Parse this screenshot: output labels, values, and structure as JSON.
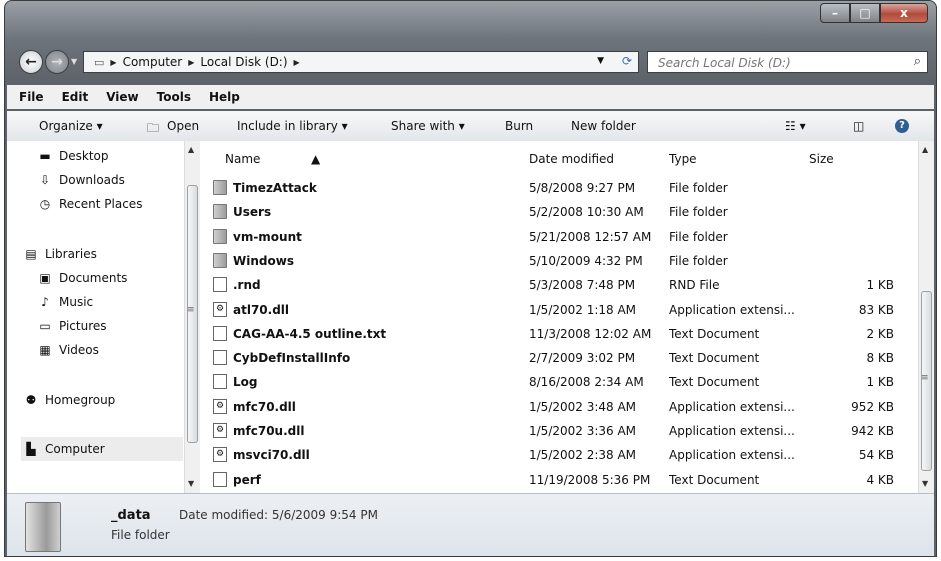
{
  "window": {
    "minimize_glyph": "–",
    "maximize_glyph": "□",
    "close_glyph": "x"
  },
  "address": {
    "crumbs": [
      "Computer",
      "Local Disk (D:)"
    ],
    "search_placeholder": "Search Local Disk (D:)"
  },
  "menu": [
    "File",
    "Edit",
    "View",
    "Tools",
    "Help"
  ],
  "toolbar": {
    "organize": "Organize ▾",
    "open": "Open",
    "include_in_library": "Include in library ▾",
    "share_with": "Share with ▾",
    "burn": "Burn",
    "new_folder": "New folder"
  },
  "nav": [
    {
      "label": "Desktop",
      "icon": "desktop-icon"
    },
    {
      "label": "Downloads",
      "icon": "downloads-icon"
    },
    {
      "label": "Recent Places",
      "icon": "recent-places-icon"
    },
    {
      "label": "Libraries",
      "icon": "libraries-icon"
    },
    {
      "label": "Documents",
      "icon": "documents-icon"
    },
    {
      "label": "Music",
      "icon": "music-icon"
    },
    {
      "label": "Pictures",
      "icon": "pictures-icon"
    },
    {
      "label": "Videos",
      "icon": "videos-icon"
    },
    {
      "label": "Homegroup",
      "icon": "homegroup-icon"
    },
    {
      "label": "Computer",
      "icon": "computer-icon"
    }
  ],
  "columns": {
    "name": "Name",
    "date": "Date modified",
    "type": "Type",
    "size": "Size"
  },
  "files": [
    {
      "name": "TimezAttack",
      "date": "5/8/2008 9:27 PM",
      "type": "File folder",
      "size": "",
      "kind": "folder"
    },
    {
      "name": "Users",
      "date": "5/2/2008 10:30 AM",
      "type": "File folder",
      "size": "",
      "kind": "folder"
    },
    {
      "name": "vm-mount",
      "date": "5/21/2008 12:57 AM",
      "type": "File folder",
      "size": "",
      "kind": "folder"
    },
    {
      "name": "Windows",
      "date": "5/10/2009 4:32 PM",
      "type": "File folder",
      "size": "",
      "kind": "folder"
    },
    {
      "name": ".rnd",
      "date": "5/3/2008 7:48 PM",
      "type": "RND File",
      "size": "1 KB",
      "kind": "doc"
    },
    {
      "name": "atl70.dll",
      "date": "1/5/2002 1:18 AM",
      "type": "Application extensi...",
      "size": "83 KB",
      "kind": "dll"
    },
    {
      "name": "CAG-AA-4.5 outline.txt",
      "date": "11/3/2008 12:02 AM",
      "type": "Text Document",
      "size": "2 KB",
      "kind": "doc"
    },
    {
      "name": "CybDefInstallInfo",
      "date": "2/7/2009 3:02 PM",
      "type": "Text Document",
      "size": "8 KB",
      "kind": "doc"
    },
    {
      "name": "Log",
      "date": "8/16/2008 2:34 AM",
      "type": "Text Document",
      "size": "1 KB",
      "kind": "doc"
    },
    {
      "name": "mfc70.dll",
      "date": "1/5/2002 3:48 AM",
      "type": "Application extensi...",
      "size": "952 KB",
      "kind": "dll"
    },
    {
      "name": "mfc70u.dll",
      "date": "1/5/2002 3:36 AM",
      "type": "Application extensi...",
      "size": "942 KB",
      "kind": "dll"
    },
    {
      "name": "msvci70.dll",
      "date": "1/5/2002 2:38 AM",
      "type": "Application extensi...",
      "size": "54 KB",
      "kind": "dll"
    },
    {
      "name": "perf",
      "date": "11/19/2008 5:36 PM",
      "type": "Text Document",
      "size": "4 KB",
      "kind": "doc"
    }
  ],
  "details": {
    "name": "_data",
    "type": "File folder",
    "modified": "Date modified: 5/6/2009 9:54 PM"
  }
}
